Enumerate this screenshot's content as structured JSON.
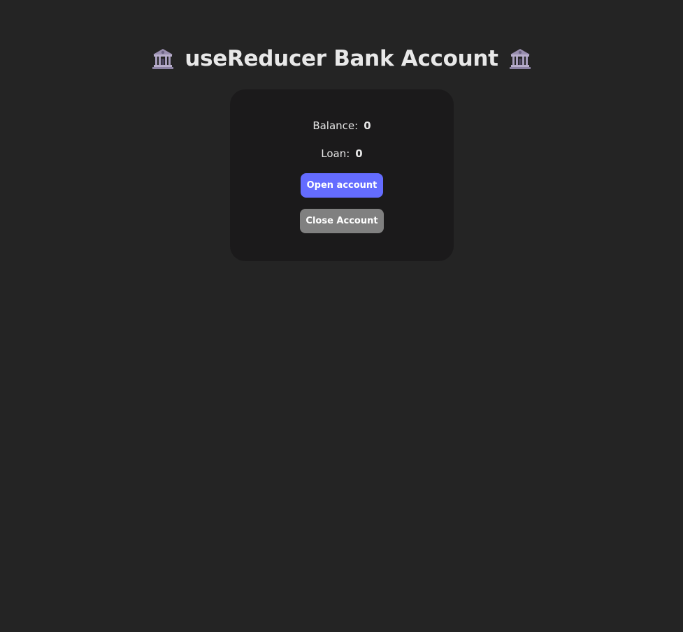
{
  "header": {
    "title": "useReducer Bank Account",
    "icon_left": "bank-building-icon",
    "icon_right": "bank-building-icon"
  },
  "account": {
    "balance_label": "Balance:",
    "balance_value": "0",
    "loan_label": "Loan:",
    "loan_value": "0"
  },
  "actions": {
    "open_label": "Open account",
    "close_label": "Close Account"
  },
  "colors": {
    "background": "#242424",
    "card": "#1b1a1b",
    "primary_button": "#646cff",
    "disabled_button": "#808080"
  }
}
